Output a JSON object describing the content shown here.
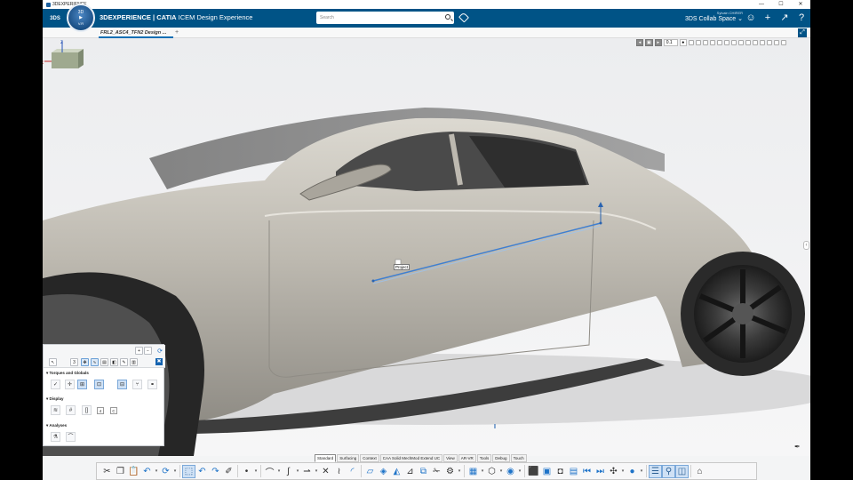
{
  "window": {
    "title": "3DEXPERIENCE",
    "controls": [
      "minimize",
      "maximize",
      "close"
    ]
  },
  "topbar": {
    "brand_bold": "3DEXPERIENCE | CATIA",
    "brand_rest": "ICEM Design Experience",
    "compass": {
      "top": "3D",
      "left": "V+R",
      "version": "V.R"
    },
    "search_placeholder": "Search",
    "user_name": "Sylvain CHIRER",
    "collab_space": "3DS Collab Space",
    "icons": [
      "user-add-icon",
      "plus-icon",
      "share-icon",
      "help-icon"
    ],
    "accent": "#005386"
  },
  "tabs": {
    "active": "FRL2_ASC4_TFN2 Design ...",
    "add": "+"
  },
  "view_toolbar": {
    "value": "0.1"
  },
  "viewport": {
    "project_label": "Project",
    "axis_x": "x",
    "axis_z": "z"
  },
  "panel": {
    "sections": [
      "Torques and Globals",
      "Display",
      "Analyses"
    ],
    "numbers": [
      "3",
      "4",
      "C"
    ],
    "close": "✖"
  },
  "workbench_tabs": [
    "Standard",
    "Surfacing",
    "Context",
    "CAA Solid MechMod Extend UC",
    "View",
    "AR-VR",
    "Tools",
    "Debug",
    "Touch"
  ],
  "workbench_active": "Standard"
}
